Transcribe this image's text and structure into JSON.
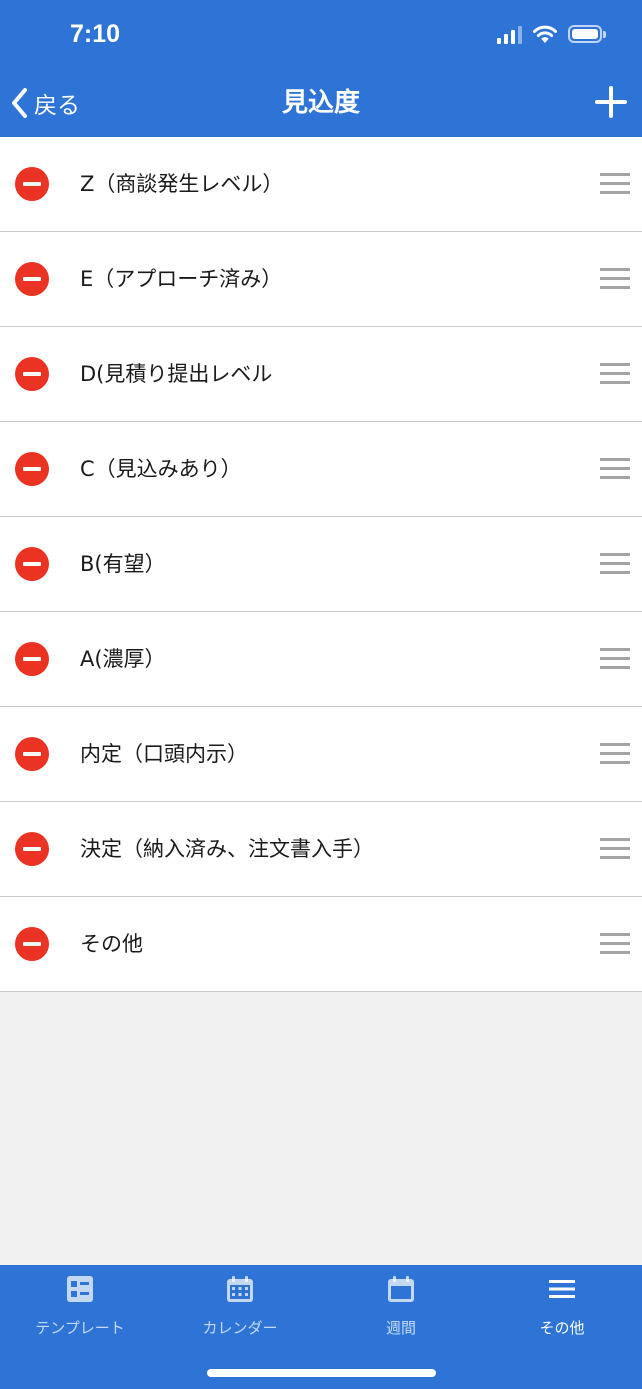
{
  "status_bar": {
    "time": "7:10"
  },
  "nav": {
    "back_label": "戻る",
    "title": "見込度",
    "add_icon": "plus-icon"
  },
  "items": [
    {
      "label": "Z（商談発生レベル）"
    },
    {
      "label": "E（アプローチ済み）"
    },
    {
      "label": "D(見積り提出レベル"
    },
    {
      "label": "C（見込みあり）"
    },
    {
      "label": "B(有望）"
    },
    {
      "label": "A(濃厚）"
    },
    {
      "label": "内定（口頭内示）"
    },
    {
      "label": "決定（納入済み、注文書入手）"
    },
    {
      "label": "その他"
    }
  ],
  "tabs": [
    {
      "label": "テンプレート",
      "icon": "template-icon",
      "active": false
    },
    {
      "label": "カレンダー",
      "icon": "calendar-icon",
      "active": false
    },
    {
      "label": "週間",
      "icon": "week-icon",
      "active": false
    },
    {
      "label": "その他",
      "icon": "menu-icon",
      "active": true
    }
  ],
  "colors": {
    "primary": "#2e74d6",
    "delete": "#eb3323",
    "background": "#f0f0f0",
    "separator": "#c8c8cc",
    "handle": "#a3a3a3"
  }
}
